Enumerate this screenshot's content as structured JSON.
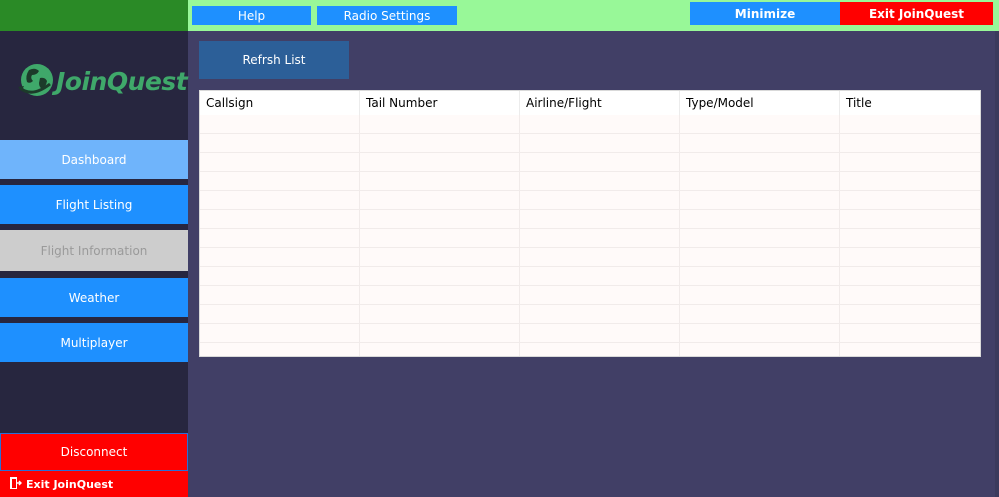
{
  "topbar": {
    "help_label": "Help",
    "radio_settings_label": "Radio Settings",
    "minimize_label": "Minimize",
    "exit_label": "Exit JoinQuest"
  },
  "sidebar": {
    "logo_text": "JoinQuest",
    "items": [
      {
        "label": "Dashboard",
        "state": "active"
      },
      {
        "label": "Flight Listing",
        "state": "normal"
      },
      {
        "label": "Flight Information",
        "state": "disabled"
      },
      {
        "label": "Weather",
        "state": "normal"
      },
      {
        "label": "Multiplayer",
        "state": "normal"
      }
    ],
    "disconnect_label": "Disconnect",
    "exit_label": "Exit JoinQuest"
  },
  "main": {
    "refresh_label": "Refrsh List",
    "table": {
      "columns": [
        "Callsign",
        "Tail Number",
        "Airline/Flight",
        "Type/Model",
        "Title"
      ],
      "rows": []
    }
  },
  "colors": {
    "accent_blue": "#1e90ff",
    "danger_red": "#ff0000",
    "topbar_green": "#98f898",
    "background": "#413f66",
    "sidebar": "#27263f",
    "logo_green": "#3fa86a"
  }
}
